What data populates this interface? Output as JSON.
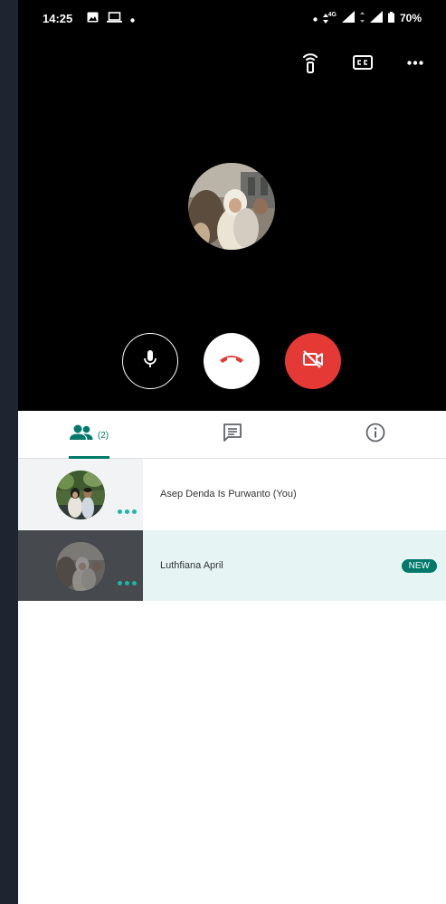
{
  "status_bar": {
    "time": "14:25",
    "network": "4G",
    "battery": "70%"
  },
  "call": {
    "top_actions": [
      "cast-icon",
      "closed-captions-icon",
      "more-options-icon"
    ],
    "controls": [
      {
        "name": "microphone",
        "icon": "microphone-icon",
        "color": "#ffffff"
      },
      {
        "name": "end-call",
        "icon": "end-call-icon",
        "color": "#e53935"
      },
      {
        "name": "camera-off",
        "icon": "video-off-icon",
        "color": "#e53935"
      }
    ]
  },
  "tabs": {
    "people_count": "(2)",
    "items": [
      "people-icon",
      "chat-icon",
      "info-icon"
    ],
    "active": "people",
    "accent": "#00796b"
  },
  "participants": [
    {
      "name": "Asep Denda Is Purwanto (You)",
      "badge": ""
    },
    {
      "name": "Luthfiana April",
      "badge": "NEW"
    }
  ],
  "colors": {
    "call_background": "#000000",
    "new_row_highlight": "#e6f5f4",
    "badge": "#00796b",
    "dots": "#1fb5a4"
  }
}
